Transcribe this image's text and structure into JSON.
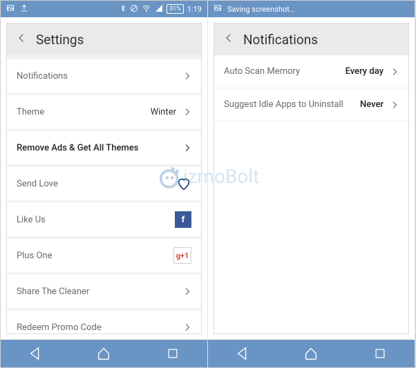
{
  "left": {
    "status": {
      "battery": "31%",
      "time": "1:19"
    },
    "header": {
      "title": "Settings"
    },
    "rows": {
      "notifications": "Notifications",
      "theme_label": "Theme",
      "theme_value": "Winter",
      "remove_ads": "Remove Ads & Get All Themes",
      "send_love": "Send Love",
      "like_us": "Like Us",
      "plus_one": "Plus One",
      "gplus_text": "+1",
      "fb_text": "f",
      "share": "Share The Cleaner",
      "redeem": "Redeem Promo Code"
    }
  },
  "right": {
    "status": {
      "saving": "Saving screenshot…"
    },
    "header": {
      "title": "Notifications"
    },
    "rows": {
      "auto_scan_label": "Auto Scan Memory",
      "auto_scan_value": "Every day",
      "suggest_label": "Suggest Idle Apps to Uninstall",
      "suggest_value": "Never"
    }
  },
  "watermark": "izmoBolt"
}
